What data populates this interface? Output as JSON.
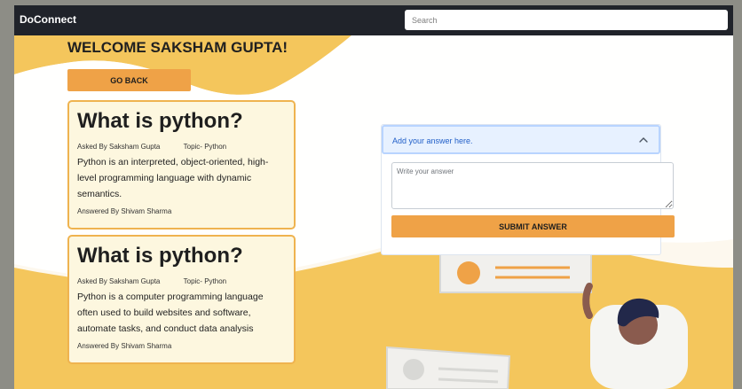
{
  "app": {
    "brand": "DoConnect"
  },
  "search": {
    "placeholder": "Search"
  },
  "welcome": "WELCOME SAKSHAM GUPTA!",
  "go_back": "GO BACK",
  "questions": [
    {
      "title": "What is python?",
      "asked_by": "Asked By Saksham Gupta",
      "topic": "Topic- Python",
      "answer": "Python is an interpreted, object-oriented, high-level programming language with dynamic semantics.",
      "answered_by": "Answered By Shivam Sharma"
    },
    {
      "title": "What is python?",
      "asked_by": "Asked By Saksham Gupta",
      "topic": "Topic- Python",
      "answer": "Python is a computer programming language often used to build websites and software, automate tasks, and conduct data analysis",
      "answered_by": "Answered By Shivam Sharma"
    }
  ],
  "answer_panel": {
    "title": "Add your answer here.",
    "placeholder": "Write your answer",
    "submit": "SUBMIT ANSWER"
  },
  "colors": {
    "accent": "#efa247",
    "background": "#f4c65c",
    "card": "#fdf7df",
    "navbar": "#20232a"
  }
}
